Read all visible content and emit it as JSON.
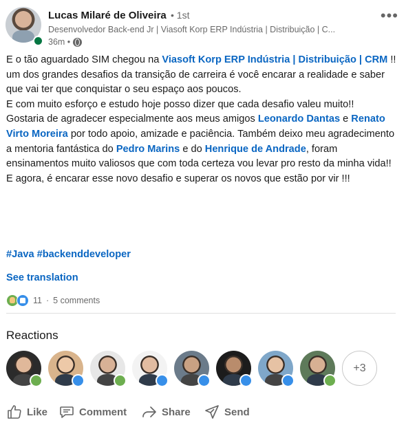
{
  "author": {
    "name": "Lucas Milaré de Oliveira",
    "degree": "• 1st",
    "headline": "Desenvolvedor Back-end Jr | Viasoft Korp ERP Indústria | Distribuição | C...",
    "time": "36m •"
  },
  "post": {
    "p1_a": "E o tão aguardado SIM chegou na ",
    "p1_mention": "Viasoft Korp ERP Indústria | Distribuição | CRM",
    "p1_b": " !! um dos grandes desafios da transição de carreira é você encarar a realidade e saber que vai ter que conquistar o seu espaço aos poucos.",
    "p2": "E com muito esforço e estudo hoje posso dizer que cada desafio valeu muito!!",
    "p3_a": "Gostaria de agradecer especialmente aos meus amigos ",
    "p3_m1": "Leonardo Dantas",
    "p3_b": " e ",
    "p3_m2": "Renato Virto Moreira",
    "p3_c": " por todo apoio, amizade e paciência. Também deixo meu agradecimento a mentoria fantástica do ",
    "p3_m3": "Pedro Marins",
    "p3_d": " e do ",
    "p3_m4": "Henrique de Andrade",
    "p3_e": ", foram ensinamentos muito valiosos que com toda certeza vou levar pro resto da minha vida!!",
    "p4": "E agora, é encarar esse novo desafio e superar os novos que estão por vir !!!"
  },
  "hashtags": [
    "#Java",
    "#backenddeveloper"
  ],
  "see_translation": "See translation",
  "social": {
    "reactions_count": "11",
    "separator": "·",
    "comments": "5 comments"
  },
  "reactions_title": "Reactions",
  "reactors": [
    {
      "badge": "support",
      "bg": "#2b2b2b",
      "skin": "#e0b89a"
    },
    {
      "badge": "like",
      "bg": "#d9b48c",
      "skin": "#edc9a8"
    },
    {
      "badge": "support",
      "bg": "#e7e7e7",
      "skin": "#d8b196"
    },
    {
      "badge": "like",
      "bg": "#f3f3f3",
      "skin": "#e2bca1"
    },
    {
      "badge": "like",
      "bg": "#6b7b8a",
      "skin": "#c9a183"
    },
    {
      "badge": "like",
      "bg": "#1c1c1c",
      "skin": "#b98c6c"
    },
    {
      "badge": "like",
      "bg": "#7fa7c9",
      "skin": "#e6c2a4"
    },
    {
      "badge": "support",
      "bg": "#5e7a5a",
      "skin": "#d7b093"
    }
  ],
  "reactors_more": "+3",
  "actions": {
    "like": "Like",
    "comment": "Comment",
    "share": "Share",
    "send": "Send"
  },
  "colors": {
    "link": "#0a66c2",
    "support": "#6dae4f",
    "like": "#378fe9",
    "online": "#057642"
  }
}
